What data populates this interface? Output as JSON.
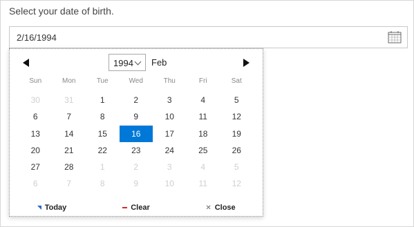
{
  "prompt": "Select your date of birth.",
  "input": {
    "value": "2/16/1994",
    "icon": "calendar-icon"
  },
  "picker": {
    "year": "1994",
    "month": "Feb",
    "weekdays": [
      "Sun",
      "Mon",
      "Tue",
      "Wed",
      "Thu",
      "Fri",
      "Sat"
    ],
    "weeks": [
      [
        [
          "30",
          true
        ],
        [
          "31",
          true
        ],
        [
          "1",
          false
        ],
        [
          "2",
          false
        ],
        [
          "3",
          false
        ],
        [
          "4",
          false
        ],
        [
          "5",
          false
        ]
      ],
      [
        [
          "6",
          false
        ],
        [
          "7",
          false
        ],
        [
          "8",
          false
        ],
        [
          "9",
          false
        ],
        [
          "10",
          false
        ],
        [
          "11",
          false
        ],
        [
          "12",
          false
        ]
      ],
      [
        [
          "13",
          false
        ],
        [
          "14",
          false
        ],
        [
          "15",
          false
        ],
        [
          "16",
          false
        ],
        [
          "17",
          false
        ],
        [
          "18",
          false
        ],
        [
          "19",
          false
        ]
      ],
      [
        [
          "20",
          false
        ],
        [
          "21",
          false
        ],
        [
          "22",
          false
        ],
        [
          "23",
          false
        ],
        [
          "24",
          false
        ],
        [
          "25",
          false
        ],
        [
          "26",
          false
        ]
      ],
      [
        [
          "27",
          false
        ],
        [
          "28",
          false
        ],
        [
          "1",
          true
        ],
        [
          "2",
          true
        ],
        [
          "3",
          true
        ],
        [
          "4",
          true
        ],
        [
          "5",
          true
        ]
      ],
      [
        [
          "6",
          true
        ],
        [
          "7",
          true
        ],
        [
          "8",
          true
        ],
        [
          "9",
          true
        ],
        [
          "10",
          true
        ],
        [
          "11",
          true
        ],
        [
          "12",
          true
        ]
      ]
    ],
    "selected_day": "16",
    "footer": {
      "today": "Today",
      "clear": "Clear",
      "close": "Close"
    }
  },
  "colors": {
    "accent": "#0078d7",
    "clear": "#d4262a",
    "today": "#2a65c8"
  }
}
